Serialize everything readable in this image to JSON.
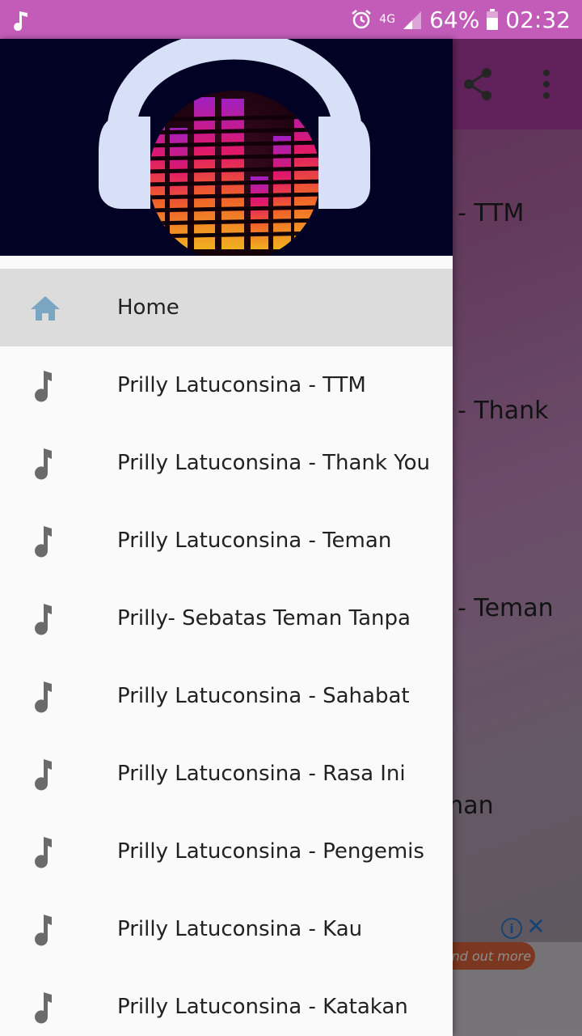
{
  "status_bar": {
    "battery": "64%",
    "time": "02:32",
    "network": "4G",
    "icons": [
      "music-note-icon",
      "alarm-icon",
      "signal-icon",
      "battery-icon"
    ]
  },
  "background": {
    "visible_fragments": [
      "- TTM",
      "- Thank",
      "- Teman",
      "man"
    ],
    "ad_button": "Find out more",
    "ad_info": "i",
    "ad_close": "✕"
  },
  "drawer": {
    "header_image": "headphones-equalizer-logo",
    "items": [
      {
        "label": "Home",
        "icon": "home-icon",
        "active": true
      },
      {
        "label": "Prilly Latuconsina - TTM",
        "icon": "music-note-icon"
      },
      {
        "label": "Prilly Latuconsina - Thank You",
        "icon": "music-note-icon"
      },
      {
        "label": "Prilly Latuconsina - Teman",
        "icon": "music-note-icon"
      },
      {
        "label": "Prilly- Sebatas Teman Tanpa",
        "icon": "music-note-icon"
      },
      {
        "label": "Prilly Latuconsina - Sahabat",
        "icon": "music-note-icon"
      },
      {
        "label": "Prilly Latuconsina - Rasa Ini",
        "icon": "music-note-icon"
      },
      {
        "label": "Prilly Latuconsina - Pengemis",
        "icon": "music-note-icon"
      },
      {
        "label": "Prilly Latuconsina - Kau",
        "icon": "music-note-icon"
      },
      {
        "label": "Prilly Latuconsina - Katakan",
        "icon": "music-note-icon"
      }
    ]
  },
  "colors": {
    "status_bar": "#c25cb8",
    "toolbar": "#b13fa6",
    "drawer_bg": "#fafafa",
    "active_item": "#dcdcdc",
    "home_icon": "#7aa6c2",
    "note_icon": "#6b6b6b"
  }
}
